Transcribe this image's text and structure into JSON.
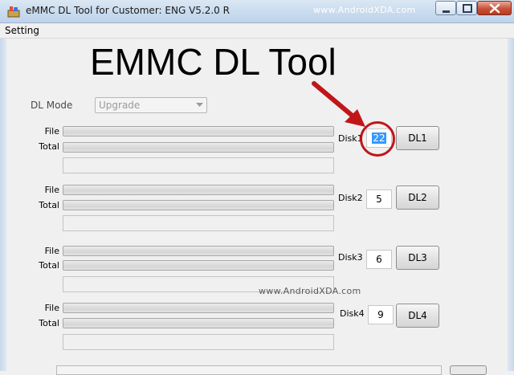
{
  "window": {
    "title": "eMMC DL Tool for Customer: ENG V5.2.0 R",
    "watermark": "www.AndroidXDA.com",
    "controls": [
      "minimize-icon",
      "maximize-icon",
      "close-icon"
    ]
  },
  "menu": {
    "items": [
      "Setting"
    ]
  },
  "caption": "EMMC DL Tool",
  "dl_mode": {
    "label": "DL Mode",
    "value": "Upgrade"
  },
  "disks": [
    {
      "file_label": "File",
      "total_label": "Total",
      "disk_label": "Disk1",
      "value": "22",
      "button": "DL1"
    },
    {
      "file_label": "File",
      "total_label": "Total",
      "disk_label": "Disk2",
      "value": "5",
      "button": "DL2"
    },
    {
      "file_label": "File",
      "total_label": "Total",
      "disk_label": "Disk3",
      "value": "6",
      "button": "DL3"
    },
    {
      "file_label": "File",
      "total_label": "Total",
      "disk_label": "Disk4",
      "value": "9",
      "button": "DL4"
    }
  ],
  "watermark_mid": "www.AndroidXDA.com",
  "colors": {
    "annotation": "#c0161a",
    "selection": "#3399ff",
    "titlebar": "#c9dbee"
  }
}
